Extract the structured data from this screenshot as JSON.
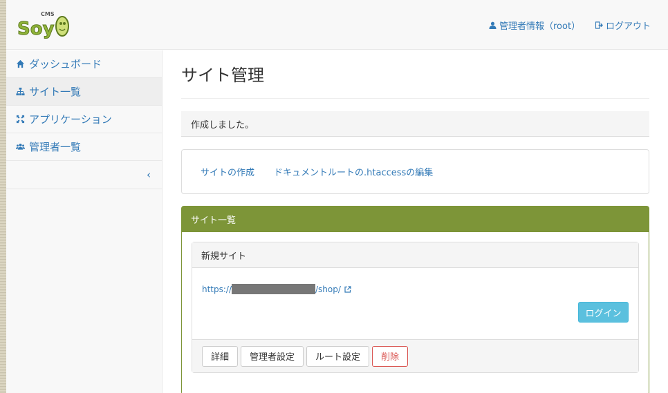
{
  "brand": {
    "logo_text": "Soy",
    "logo_sub": "CMS",
    "logo_color": "#6b8e23"
  },
  "header": {
    "admin_info": "管理者情報（root）",
    "logout": "ログアウト"
  },
  "sidebar": {
    "items": [
      {
        "label": "ダッシュボード",
        "icon": "home-icon"
      },
      {
        "label": "サイト一覧",
        "icon": "sitemap-icon"
      },
      {
        "label": "アプリケーション",
        "icon": "arrows-icon"
      },
      {
        "label": "管理者一覧",
        "icon": "users-icon"
      }
    ],
    "collapse": "‹"
  },
  "main": {
    "title": "サイト管理",
    "alert": "作成しました。",
    "links": [
      "サイトの作成",
      "ドキュメントルートの.htaccessの編集"
    ],
    "panel_title": "サイト一覧",
    "site": {
      "name": "新規サイト",
      "url_prefix": "https://",
      "url_suffix": "/shop/",
      "login": "ログイン",
      "actions": [
        "詳細",
        "管理者設定",
        "ルート設定",
        "削除"
      ]
    }
  },
  "colors": {
    "accent": "#337ab7",
    "panel_green": "#7d9538",
    "info": "#5bc0de",
    "danger": "#d9534f"
  }
}
